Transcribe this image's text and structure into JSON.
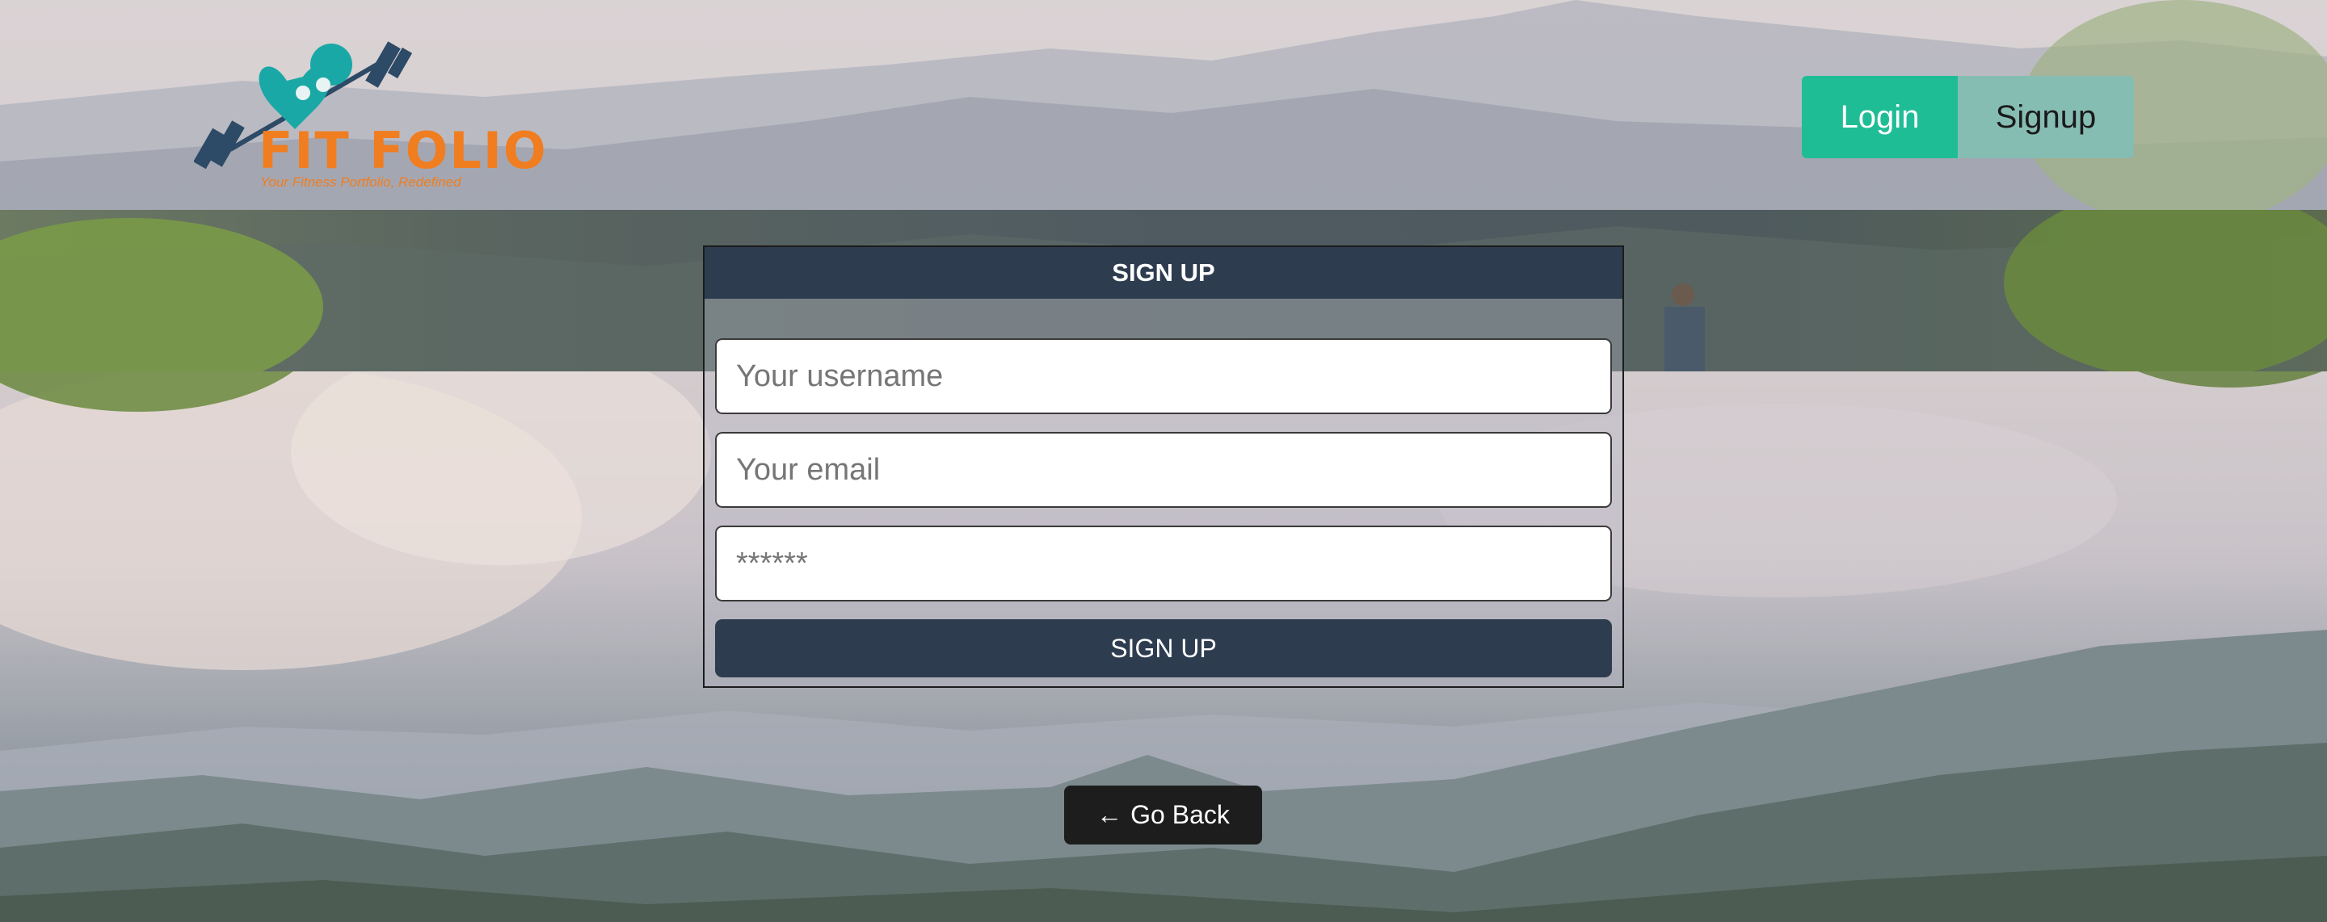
{
  "brand": {
    "name": "FIT FOLIO",
    "tagline": "Your Fitness Portfolio, Redefined",
    "accent_color": "#f07d1f",
    "icon_color": "#1aa8a6"
  },
  "nav": {
    "login_label": "Login",
    "signup_label": "Signup"
  },
  "form": {
    "title": "SIGN UP",
    "username_placeholder": "Your username",
    "email_placeholder": "Your email",
    "password_placeholder": "******",
    "submit_label": "SIGN UP"
  },
  "go_back": {
    "arrow": "←",
    "label": "Go Back"
  },
  "colors": {
    "login_bg": "#1fbd96",
    "signup_bg": "#86bdb3",
    "form_header_bg": "#2e3c50",
    "go_back_bg": "#1d1d1d"
  }
}
